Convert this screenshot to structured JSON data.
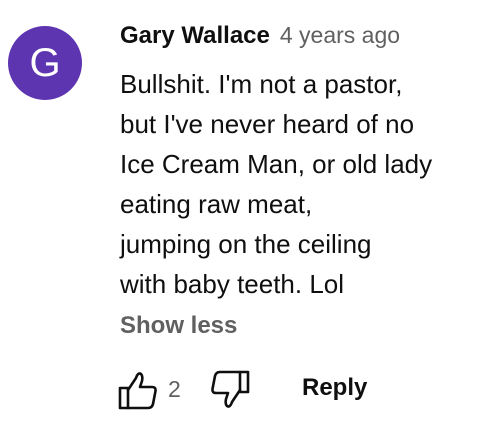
{
  "comment": {
    "avatar_letter": "G",
    "avatar_color": "#5e35b1",
    "author": "Gary Wallace",
    "timestamp": "4 years ago",
    "text_lines": [
      "Bullshit. I'm not a pastor,",
      "but I've never heard of no",
      "Ice Cream Man, or old lady",
      "eating raw meat,",
      "jumping on the ceiling",
      "with baby teeth. Lol"
    ],
    "show_less_label": "Show less",
    "like_icon": "thumbs-up-icon",
    "like_count": "2",
    "dislike_icon": "thumbs-down-icon",
    "reply_label": "Reply"
  }
}
